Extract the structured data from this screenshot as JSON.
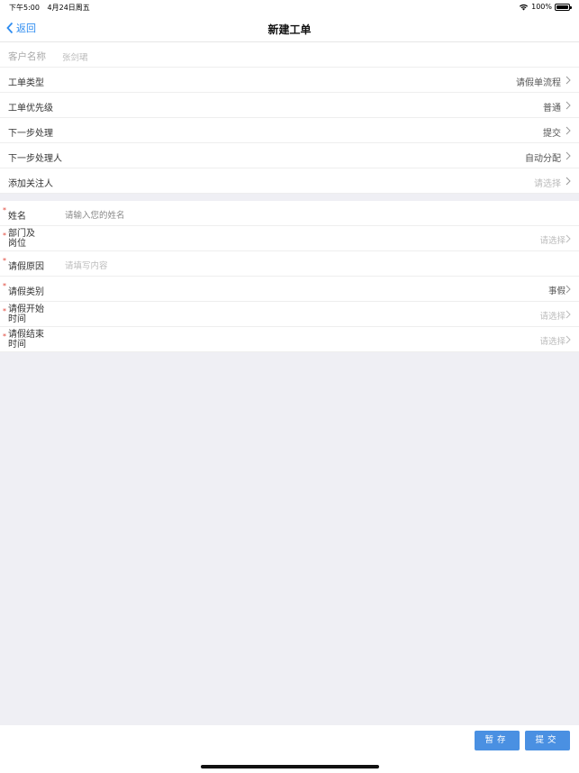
{
  "status_bar": {
    "time": "下午5:00",
    "date": "4月24日周五",
    "battery": "100%"
  },
  "nav": {
    "back_label": "返回",
    "title": "新建工单"
  },
  "ticket": {
    "customer_label": "客户名称",
    "customer_value": "张剑珺",
    "rows": [
      {
        "label": "工单类型",
        "value": "请假单流程"
      },
      {
        "label": "工单优先级",
        "value": "普通"
      },
      {
        "label": "下一步处理",
        "value": "提交"
      },
      {
        "label": "下一步处理人",
        "value": "自动分配"
      },
      {
        "label": "添加关注人",
        "value": "请选择"
      }
    ]
  },
  "form": {
    "name": {
      "label": "姓名",
      "placeholder": "请输入您的姓名"
    },
    "dept": {
      "label_line1": "部门及",
      "label_line2": "岗位",
      "value": "请选择"
    },
    "reason": {
      "label": "请假原因",
      "placeholder": "请填写内容"
    },
    "type": {
      "label": "请假类别",
      "value": "事假"
    },
    "start": {
      "label_line1": "请假开始",
      "label_line2": "时间",
      "value": "请选择"
    },
    "end": {
      "label_line1": "请假结束",
      "label_line2": "时间",
      "value": "请选择"
    }
  },
  "footer": {
    "save_label": "暂存",
    "submit_label": "提交"
  },
  "colors": {
    "accent": "#4a90e2",
    "link": "#2d8cf0",
    "required": "#e0463a",
    "background": "#efeff4"
  }
}
